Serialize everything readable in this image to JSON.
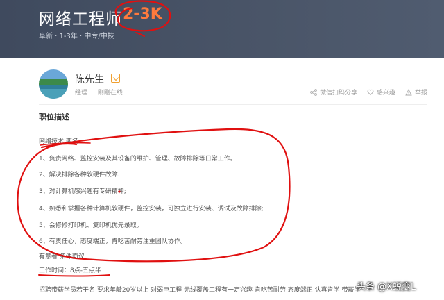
{
  "header": {
    "title": "网络工程师",
    "salary": "2-3K",
    "meta": "阜新 · 1-3年 · 中专/中技"
  },
  "recruiter": {
    "name": "陈先生",
    "role": "经理",
    "status": "刚刚在线"
  },
  "actions": {
    "share": "微信扫码分享",
    "interest": "感兴趣",
    "report": "举报"
  },
  "description": {
    "section_title": "职位描述",
    "intro": "网络技术 两名",
    "items": [
      "1、负责网络、监控安装及其设备的维护、管理、故障排除等日常工作。",
      "2、解决排除各种软硬件故障.",
      "3、对计算机感兴趣有专研精神;",
      "4、熟悉和掌握各种计算机软硬件，监控安装，可独立进行安装、调试及故障排除;",
      "5、会修修打印机、复印机优先录取。",
      "6、有责任心，态度端正，肯吃苦耐劳注重团队协作。"
    ],
    "salary_note": "有意者 条件面议",
    "work_time": "工作时间：8点-五点半",
    "recruit": "招聘带薪学员若干名 要求年龄20岁以上 对弱电工程 无线覆盖工程有一定兴趣 肯吃苦耐劳 态度端正 认真肯学 带薪学"
  },
  "watermark": "头条 @X蜕变L",
  "colors": {
    "header_bg": "#454f63",
    "salary": "#ff7a3d",
    "annotation_red": "#e01010"
  }
}
